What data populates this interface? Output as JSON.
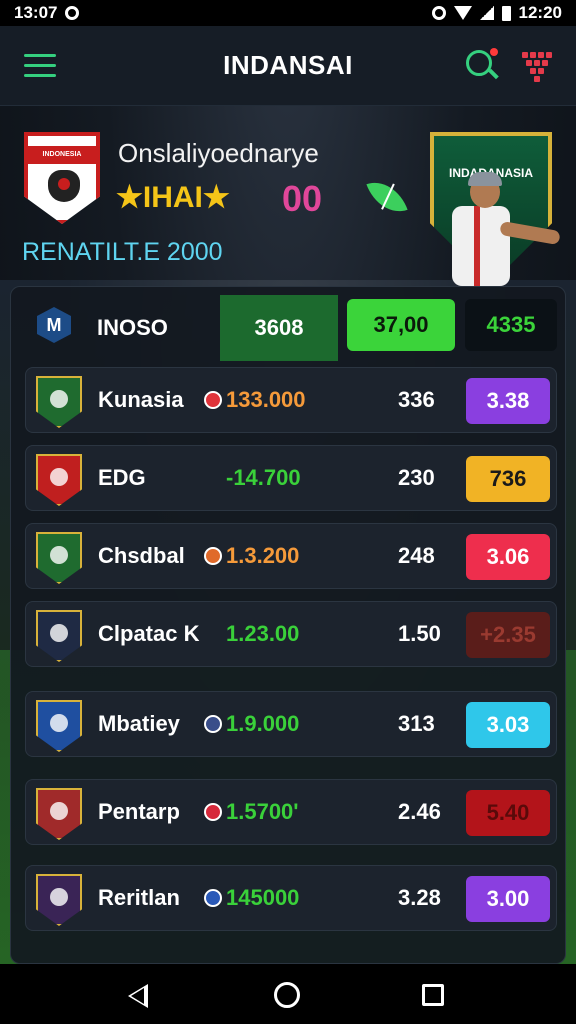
{
  "status_bar": {
    "time_left": "13:07",
    "time_right": "12:20"
  },
  "app": {
    "title": "INDANSAI"
  },
  "hero": {
    "crest_text": "INDONESIA",
    "team_name": "Onslaliyoednarye",
    "subtitle": "★IHAI★",
    "score": "00",
    "tagline": "RENATILT.E 2000",
    "shield_text": "INDADANASIA"
  },
  "table": {
    "header": {
      "label": "INOSO",
      "col1": "3608",
      "col2": "37,00",
      "col3": "4335"
    },
    "rows": [
      {
        "name": "Kunasia",
        "odds": "133.000",
        "mid": "336",
        "pill": "3.38",
        "odds_color": "#f59a3a",
        "pill_color": "#8a3fe0",
        "chip_color": "#e0333a",
        "badge_color": "#1f6b2f"
      },
      {
        "name": "EDG",
        "odds": "-14.700",
        "mid": "230",
        "pill": "736",
        "odds_color": "#3ad13a",
        "pill_color": "#f1b325",
        "chip_color": "",
        "badge_color": "#c01f1f"
      },
      {
        "name": "Chsdbal",
        "odds": "1.3.200",
        "mid": "248",
        "pill": "3.06",
        "odds_color": "#f59a3a",
        "pill_color": "#ee2e4d",
        "chip_color": "#e06a2a",
        "badge_color": "#1f6b2f"
      },
      {
        "name": "Clpatac K",
        "odds": "1.23.00",
        "mid": "1.50",
        "pill": "+2.35",
        "odds_color": "#3ad13a",
        "pill_color": "#5a1d1a",
        "chip_color": "",
        "badge_color": "#1f2a44"
      },
      {
        "name": "Mbatiey",
        "odds": "1.9.000",
        "mid": "313",
        "pill": "3.03",
        "odds_color": "#3ad13a",
        "pill_color": "#2fc7ea",
        "chip_color": "#3a4e8a",
        "badge_color": "#1f4fa0"
      },
      {
        "name": "Pentarp",
        "odds": "1.5700'",
        "mid": "2.46",
        "pill": "5.40",
        "odds_color": "#3ad13a",
        "pill_color": "#b3141a",
        "chip_color": "#d6283a",
        "badge_color": "#a02a2a"
      },
      {
        "name": "Reritlan",
        "odds": "145000",
        "mid": "3.28",
        "pill": "3.00",
        "odds_color": "#3ad13a",
        "pill_color": "#8a3fe0",
        "chip_color": "#2a59b8",
        "badge_color": "#3a2456"
      }
    ]
  }
}
